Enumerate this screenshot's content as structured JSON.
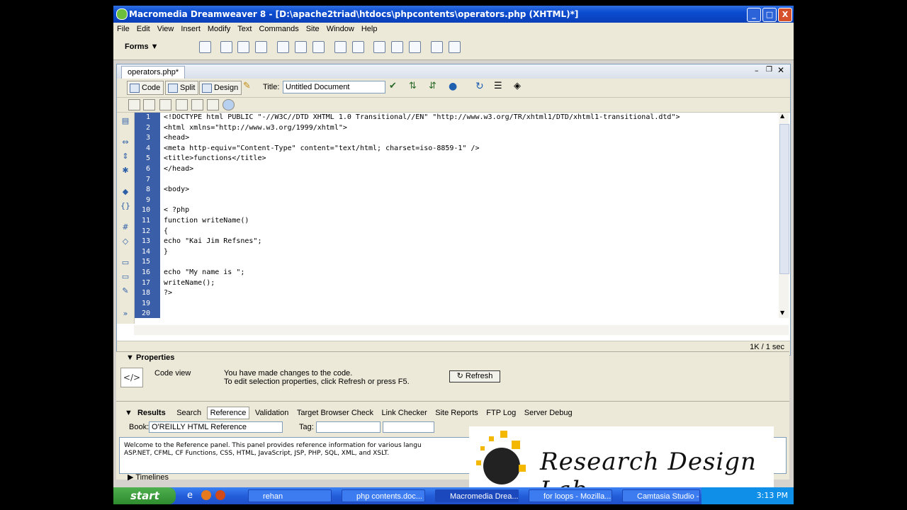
{
  "window": {
    "title": "Macromedia Dreamweaver 8 - [D:\\apache2triad\\htdocs\\phpcontents\\operators.php (XHTML)*]",
    "controls": [
      "_",
      "□",
      "X"
    ]
  },
  "menu": [
    "File",
    "Edit",
    "View",
    "Insert",
    "Modify",
    "Text",
    "Commands",
    "Site",
    "Window",
    "Help"
  ],
  "insert_bar": {
    "category": "Forms"
  },
  "document": {
    "tab": "operators.php*",
    "views": {
      "code": "Code",
      "split": "Split",
      "design": "Design"
    },
    "title_label": "Title:",
    "title_value": "Untitled Document",
    "status": "1K / 1 sec"
  },
  "code_lines": [
    {
      "n": "1",
      "t": "<!DOCTYPE html PUBLIC \"-//W3C//DTD XHTML 1.0 Transitional//EN\" \"http://www.w3.org/TR/xhtml1/DTD/xhtml1-transitional.dtd\">"
    },
    {
      "n": "2",
      "t": "<html xmlns=\"http://www.w3.org/1999/xhtml\">"
    },
    {
      "n": "3",
      "t": "<head>"
    },
    {
      "n": "4",
      "t": "<meta http-equiv=\"Content-Type\" content=\"text/html; charset=iso-8859-1\" />"
    },
    {
      "n": "5",
      "t": "<title>functions</title>"
    },
    {
      "n": "6",
      "t": "</head>"
    },
    {
      "n": "7",
      "t": ""
    },
    {
      "n": "8",
      "t": "<body>"
    },
    {
      "n": "9",
      "t": ""
    },
    {
      "n": "10",
      "t": "< ?php"
    },
    {
      "n": "11",
      "t": "function writeName()"
    },
    {
      "n": "12",
      "t": "{"
    },
    {
      "n": "13",
      "t": "echo \"Kai Jim Refsnes\";"
    },
    {
      "n": "14",
      "t": "}"
    },
    {
      "n": "15",
      "t": ""
    },
    {
      "n": "16",
      "t": "echo \"My name is \";"
    },
    {
      "n": "17",
      "t": "writeName();"
    },
    {
      "n": "18",
      "t": "?>"
    },
    {
      "n": "19",
      "t": ""
    },
    {
      "n": "20",
      "t": ""
    }
  ],
  "properties": {
    "header": "Properties",
    "view_label": "Code view",
    "message_line1": "You have made changes to the code.",
    "message_line2": "To edit selection properties, click Refresh or press F5.",
    "refresh": "Refresh"
  },
  "results": {
    "header": "Results",
    "tabs": [
      "Search",
      "Reference",
      "Validation",
      "Target Browser Check",
      "Link Checker",
      "Site Reports",
      "FTP Log",
      "Server Debug"
    ],
    "active_tab": "Reference",
    "book_label": "Book:",
    "book_value": "O'REILLY HTML Reference",
    "tag_label": "Tag:",
    "reference_text_line1": "Welcome to the Reference panel. This panel provides reference information for various langu",
    "reference_text_line2": "ASP.NET, CFML, CF Functions, CSS, HTML, JavaScript, JSP, PHP, SQL, XML, and XSLT.",
    "timelines": "Timelines"
  },
  "watermark": {
    "text": "Research Design Lab"
  },
  "taskbar": {
    "start": "start",
    "tasks": [
      "rehan",
      "php contents.doc...",
      "Macromedia Drea...",
      "for loops - Mozilla...",
      "Camtasia Studio -..."
    ],
    "active_task": "Macromedia Drea...",
    "clock": "3:13 PM"
  }
}
